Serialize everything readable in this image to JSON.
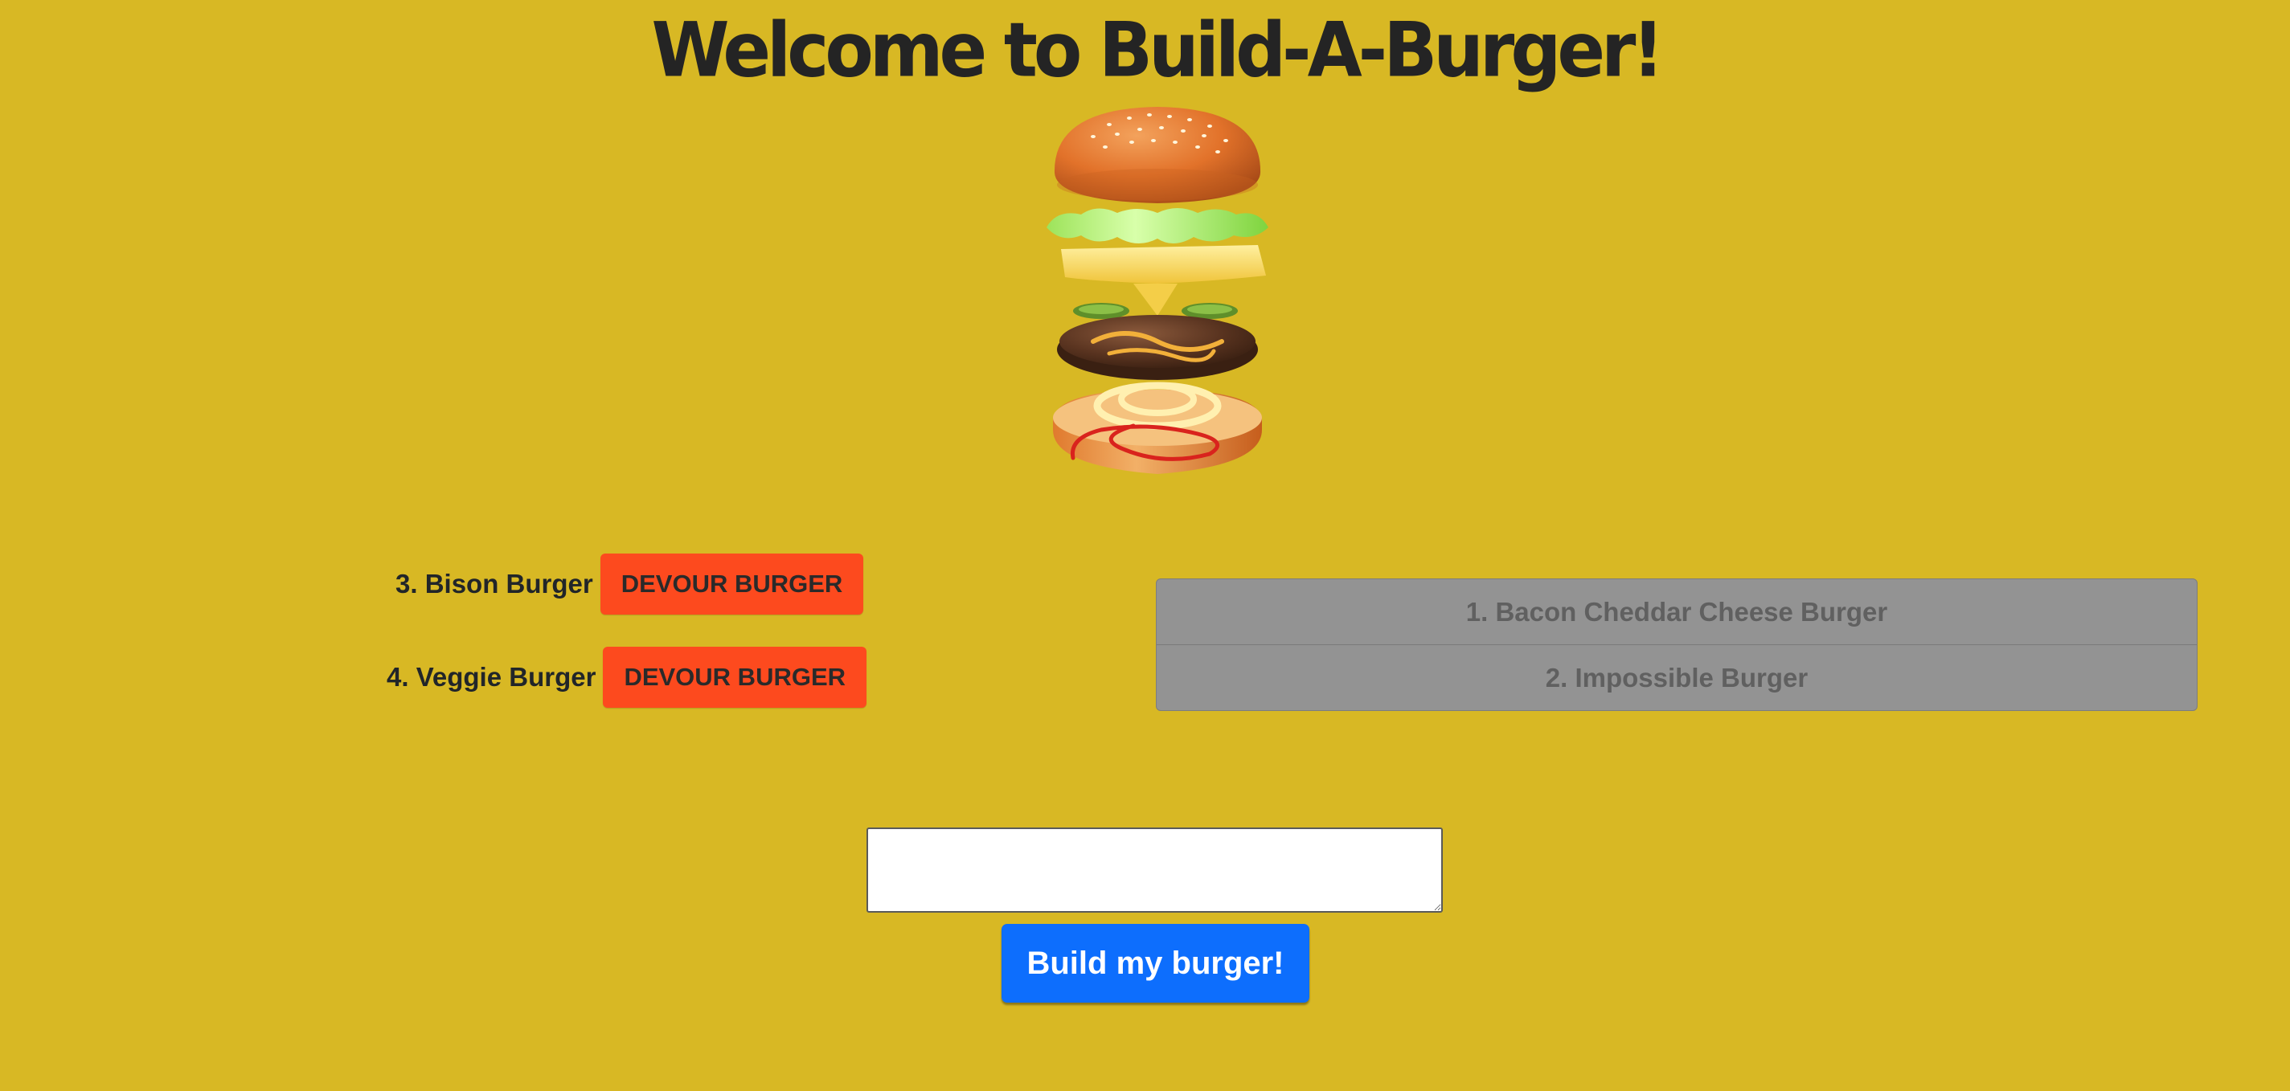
{
  "header": {
    "title": "Welcome to Build-A-Burger!"
  },
  "hero": {
    "image": "burger-illustration"
  },
  "burgers_to_eat": [
    {
      "label": "3. Bison Burger",
      "button_label": "DEVOUR BURGER"
    },
    {
      "label": "4. Veggie Burger",
      "button_label": "DEVOUR BURGER"
    }
  ],
  "devoured_burgers": [
    {
      "label": "1. Bacon Cheddar Cheese Burger"
    },
    {
      "label": "2. Impossible Burger"
    }
  ],
  "form": {
    "input_value": "",
    "submit_label": "Build my burger!"
  },
  "colors": {
    "background": "#d8b824",
    "devour_button": "#fd4a1e",
    "submit_button": "#0d6efd",
    "devoured_list": "#939393"
  }
}
